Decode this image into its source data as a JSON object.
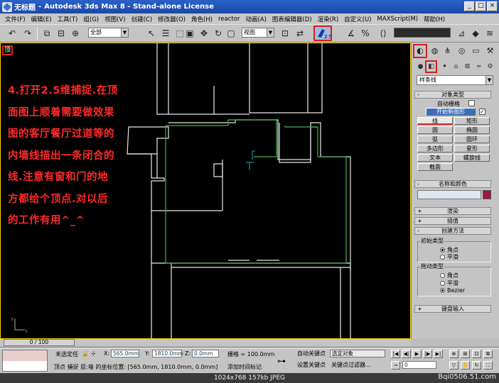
{
  "window": {
    "tab_title": "无标题",
    "title": "Autodesk 3ds Max 8 - Stand-alone License",
    "minimize": "_",
    "maximize": "□",
    "close": "×"
  },
  "menu": [
    "文件(F)",
    "编辑(E)",
    "工具(T)",
    "组(G)",
    "视图(V)",
    "创建(C)",
    "修改器(O)",
    "角色(H)",
    "reactor",
    "动画(A)",
    "图表编辑器(D)",
    "渲染(R)",
    "自定义(U)",
    "MAXScript(M)",
    "帮助(H)"
  ],
  "toolbar": {
    "selection_filter": "全部",
    "ref_coord": "视图",
    "snap_value": "2.5"
  },
  "viewport": {
    "label": "顶",
    "instruction_text": "4.打开2.5维捕捉.在顶\n面图上顺着需要做效果\n图的客厅餐厅过道等的\n内墙线描出一条闭合的\n线.注意有窗和门的地\n方都给个顶点.对以后\n的工作有用^_^"
  },
  "command_panel": {
    "category": "样条线",
    "object_type_title": "对象类型",
    "auto_grid": "自动栅格",
    "start_new_shape": "开始新图形",
    "shape_buttons": [
      "线",
      "矩形",
      "圆",
      "椭圆",
      "弧",
      "圆环",
      "多边形",
      "星形",
      "文本",
      "螺旋线",
      "截面"
    ],
    "name_color_title": "名称和颜色",
    "render_title": "渲染",
    "interpolation_title": "插值",
    "creation_method_title": "创建方法",
    "initial_type_label": "初始类型",
    "initial_options": [
      "角点",
      "平滑"
    ],
    "drag_type_label": "拖动类型",
    "drag_options": [
      "角点",
      "平滑",
      "Bezier"
    ],
    "keyboard_input_title": "键盘输入",
    "name_swatch_color": "#9c1a3c"
  },
  "timeline": {
    "frame": "0 / 100"
  },
  "status": {
    "selection": "未选定任",
    "x_label": "X:",
    "x_value": "565.0mm",
    "y_label": "Y:",
    "y_value": "1810.0mm",
    "z_label": "Z:",
    "z_value": "0.0mm",
    "grid": "栅格 = 100.0mm",
    "auto_key": "自动关键点",
    "auto_key_set": "选定对象",
    "set_key": "设置关键点",
    "key_filters": "关键点过滤器...",
    "prompt": "顶点 捕捉 层:墙 的坐标位置:  [565.0mm, 1810.0mm, 0.0mm]",
    "add_time_tag": "添加时间标记",
    "frame_value": "0"
  },
  "caption": "1024x768  157kb  JPEG",
  "watermark": "Bqi0506.51.com",
  "colors": {
    "title_bar": "#1c48a8",
    "annotation_red": "#d42020",
    "instruction_text": "#ff2a2a",
    "wall_lines": "#ffffff",
    "spline_line": "#4caf50"
  }
}
